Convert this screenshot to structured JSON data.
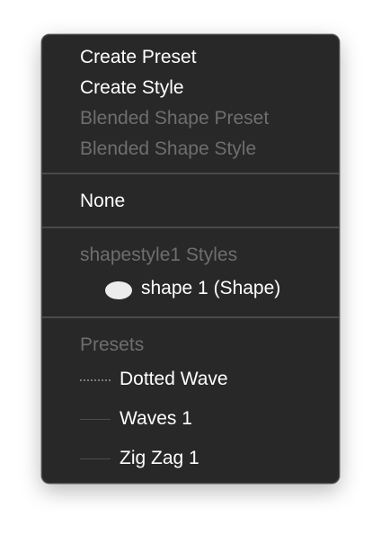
{
  "menu": {
    "items": {
      "create_preset": "Create Preset",
      "create_style": "Create Style",
      "blended_shape_preset": "Blended Shape Preset",
      "blended_shape_style": "Blended Shape Style",
      "none": "None"
    },
    "styles_section": {
      "header": "shapestyle1 Styles",
      "items": [
        {
          "label": "shape 1 (Shape)",
          "icon": "ellipse-icon"
        }
      ]
    },
    "presets_section": {
      "header": "Presets",
      "items": [
        {
          "label": "Dotted Wave",
          "icon": "dotted-line-icon"
        },
        {
          "label": "Waves 1",
          "icon": "line-icon"
        },
        {
          "label": "Zig Zag 1",
          "icon": "line-icon"
        }
      ]
    }
  },
  "colors": {
    "menu_background": "#282828",
    "enabled_text": "#ffffff",
    "disabled_text": "#6e6e6e",
    "separator": "#4a4a4a"
  }
}
